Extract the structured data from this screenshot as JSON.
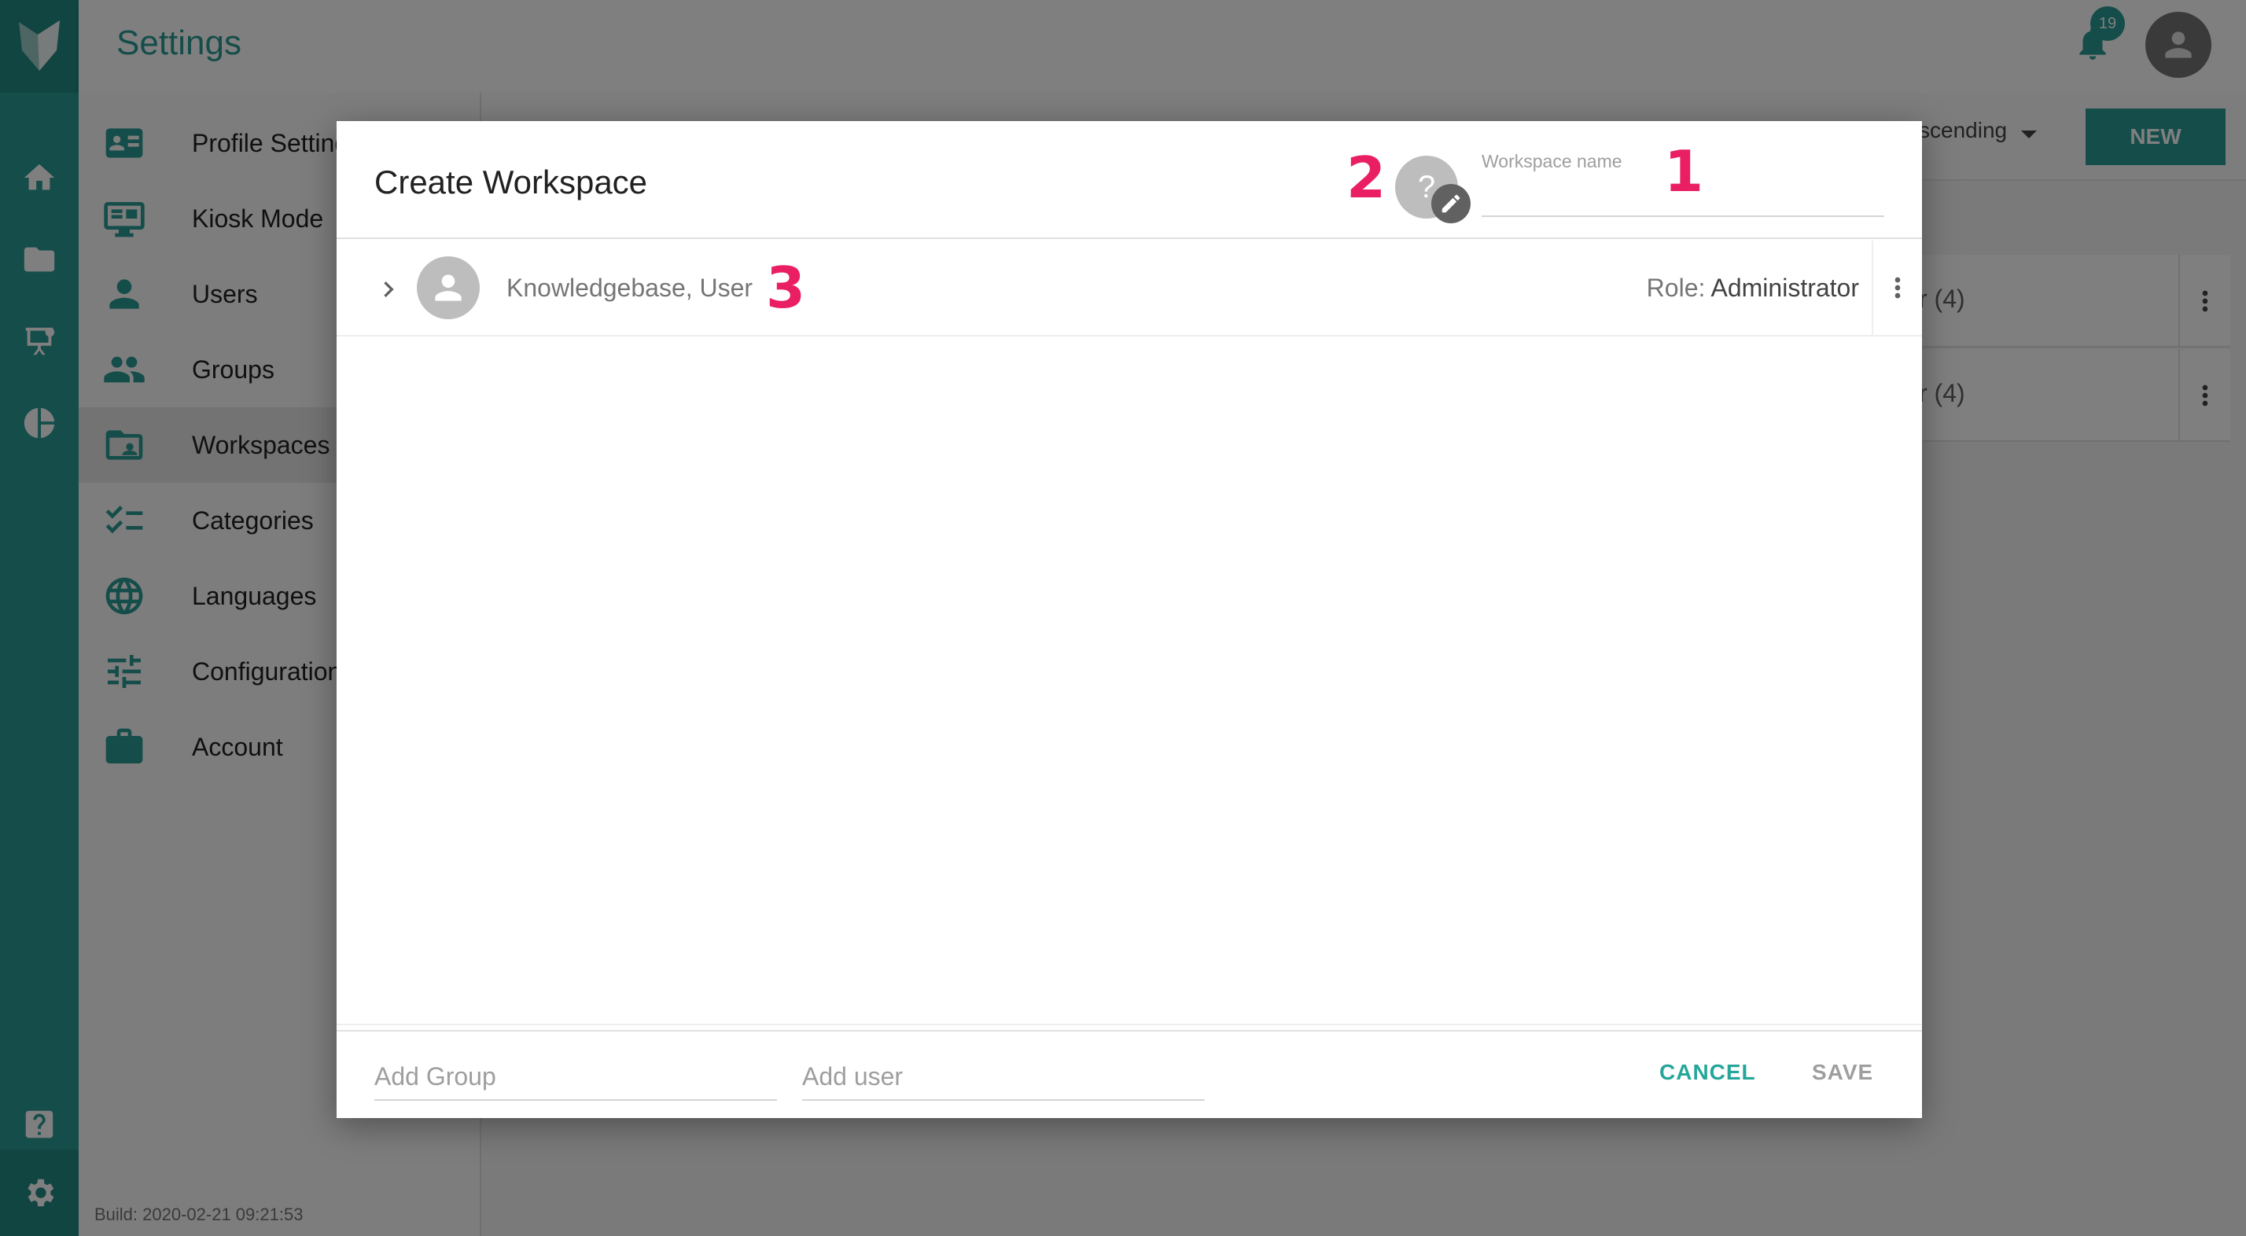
{
  "app": {
    "title": "Settings",
    "notifications_count": "19"
  },
  "sidebar": {
    "items": [
      {
        "label": "Profile Settings",
        "icon": "profile-card-icon"
      },
      {
        "label": "Kiosk Mode",
        "icon": "monitor-icon"
      },
      {
        "label": "Users",
        "icon": "person-icon"
      },
      {
        "label": "Groups",
        "icon": "people-icon"
      },
      {
        "label": "Workspaces",
        "icon": "folder-shared-icon",
        "active": true
      },
      {
        "label": "Categories",
        "icon": "checklist-icon"
      },
      {
        "label": "Languages",
        "icon": "globe-icon"
      },
      {
        "label": "Configuration",
        "icon": "sliders-icon"
      },
      {
        "label": "Account",
        "icon": "briefcase-icon"
      }
    ],
    "build": "Build: 2020-02-21 09:21:53"
  },
  "toolbar": {
    "sort_label": "scending",
    "new_label": "NEW"
  },
  "cards": [
    {
      "text": "r (4)"
    },
    {
      "text": "r (4)"
    }
  ],
  "dialog": {
    "title": "Create Workspace",
    "workspace_avatar_text": "?",
    "workspace_name_label": "Workspace name",
    "workspace_name_value": "",
    "members": [
      {
        "name": "Knowledgebase, User",
        "role_label": "Role:",
        "role_value": "Administrator"
      }
    ],
    "footer": {
      "add_group_placeholder": "Add Group",
      "add_user_placeholder": "Add user",
      "cancel_label": "CANCEL",
      "save_label": "SAVE"
    },
    "annotations": {
      "one": "1",
      "two": "2",
      "three": "3"
    }
  },
  "colors": {
    "accent": "#2a9a94",
    "annotation": "#e91e63",
    "cancel": "#26a69a",
    "disabled": "#9e9e9e"
  }
}
